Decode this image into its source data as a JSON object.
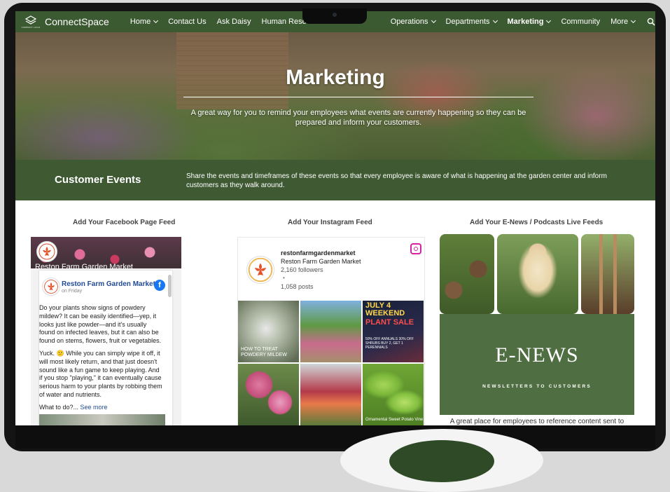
{
  "nav": {
    "logo_caption": "COMPANY LOGO",
    "brand": "ConnectSpace",
    "items": [
      {
        "label": "Home",
        "dropdown": true
      },
      {
        "label": "Contact Us",
        "dropdown": false
      },
      {
        "label": "Ask Daisy",
        "dropdown": false
      },
      {
        "label": "Human Reso",
        "dropdown": false
      },
      {
        "label": "Operations",
        "dropdown": true
      },
      {
        "label": "Departments",
        "dropdown": true
      },
      {
        "label": "Marketing",
        "dropdown": true,
        "active": true
      },
      {
        "label": "Community",
        "dropdown": false
      },
      {
        "label": "More",
        "dropdown": true
      }
    ],
    "search_icon": "search-icon"
  },
  "hero": {
    "title": "Marketing",
    "subtitle": "A great way for you to remind your employees what events are currently happening so they can be prepared and inform your customers."
  },
  "events": {
    "title": "Customer Events",
    "description": "Share the events and timeframes of these events so that every employee is aware of what is happening at the garden center and inform customers as they walk around."
  },
  "facebook": {
    "heading": "Add Your Facebook Page Feed",
    "cover_name": "Reston Farm Garden Market",
    "page_name": "Reston Farm Garden Market",
    "time": "on Friday",
    "icon": "facebook-icon",
    "paragraph1": "Do your plants show signs of powdery mildew? It can be easily identified—yep, it looks just like powder—and it's usually found on infected leaves, but it can also be found on stems, flowers, fruit or vegetables.",
    "paragraph2": "Yuck. 😕 While you can simply wipe it off, it will most likely return, and that just doesn't sound like a fun game to keep playing. And if you stop \"playing,\" it can eventually cause serious harm to your plants by robbing them of water and nutrients.",
    "teaser": "What to do?...",
    "see_more": "See more"
  },
  "instagram": {
    "heading": "Add Your Instagram Feed",
    "handle": "restonfarmgardenmarket",
    "name": "Reston Farm Garden Market",
    "followers": "2,160 followers",
    "separator": "•",
    "posts": "1,058 posts",
    "icon": "instagram-icon",
    "tile1_caption": "How to treat powdery mildew",
    "tile3_line1": "JULY 4 WEEKEND",
    "tile3_line2": "PLANT SALE",
    "tile3_small": "50% OFF ANNUALS 30% OFF SHRUBS BUY 2, GET 1 PERENNIALS",
    "tile6_caption": "Ornamental Sweet Potato Vine"
  },
  "enews": {
    "heading": "Add Your E-News / Podcasts Live Feeds",
    "title": "E-NEWS",
    "subtitle": "NEWSLETTERS TO CUSTOMERS",
    "description": "A great place for employees to reference content sent to"
  },
  "colors": {
    "brand_green": "#3c5a32",
    "band_green": "#3f5a33",
    "enews_green": "#4f6e42",
    "facebook_blue": "#1877f2",
    "link_blue": "#234b97"
  }
}
